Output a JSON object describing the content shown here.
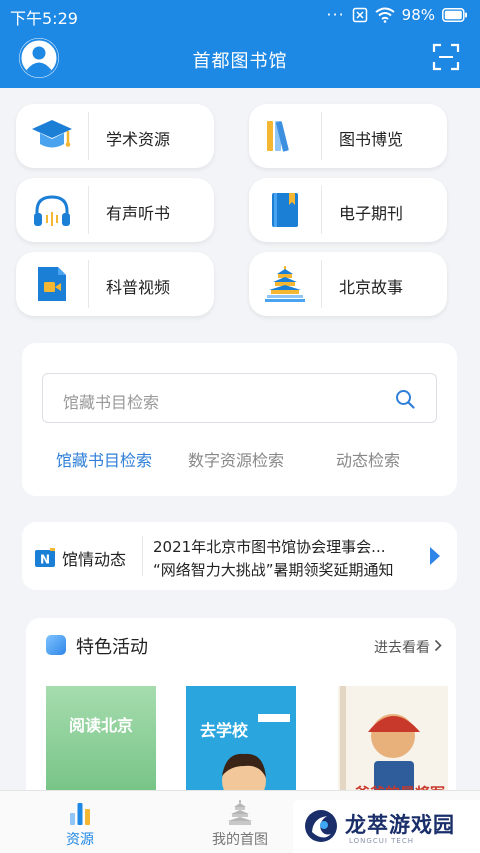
{
  "status_bar": {
    "time": "下午5:29",
    "battery": "98%"
  },
  "header": {
    "title": "首都图书馆"
  },
  "menu": [
    {
      "label": "学术资源",
      "icon": "graduation-cap-icon"
    },
    {
      "label": "图书博览",
      "icon": "books-icon"
    },
    {
      "label": "有声听书",
      "icon": "headphones-icon"
    },
    {
      "label": "电子期刊",
      "icon": "journal-icon"
    },
    {
      "label": "科普视频",
      "icon": "video-icon"
    },
    {
      "label": "北京故事",
      "icon": "temple-of-heaven-icon"
    }
  ],
  "search": {
    "placeholder": "馆藏书目检索",
    "tabs": [
      "馆藏书目检索",
      "数字资源检索",
      "动态检索"
    ],
    "active_tab": 0,
    "active_color": "#2f7fd8"
  },
  "news": {
    "label": "馆情动态",
    "items": [
      "2021年北京市图书馆协会理事会...",
      "“网络智力大挑战”暑期领奖延期通知"
    ]
  },
  "featured": {
    "title": "特色活动",
    "more": "进去看看",
    "books": [
      {
        "cover_text": "阅读北京"
      },
      {
        "cover_text": "去学校"
      },
      {
        "cover_text": "爸爸的是将军"
      }
    ]
  },
  "bottom_nav": [
    {
      "label": "资源",
      "active": true
    },
    {
      "label": "我的首图",
      "active": false
    },
    {
      "label": "",
      "active": false
    }
  ],
  "watermark": {
    "text": "龙萃游戏园",
    "sub": "LONGCUI TECH"
  },
  "colors": {
    "primary": "#1e88e5",
    "accent": "#2f7fd8"
  }
}
